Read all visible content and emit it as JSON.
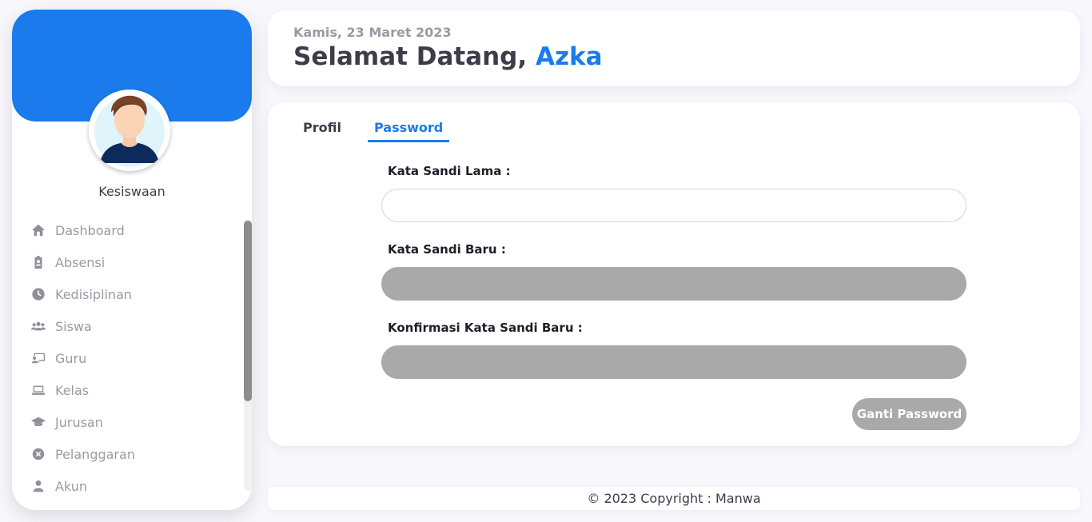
{
  "sidebar": {
    "role": "Kesiswaan",
    "accent_color": "#1b7bec",
    "items": [
      {
        "label": "Dashboard",
        "icon": "home-icon"
      },
      {
        "label": "Absensi",
        "icon": "clipboard-user-icon"
      },
      {
        "label": "Kedisiplinan",
        "icon": "clock-icon"
      },
      {
        "label": "Siswa",
        "icon": "users-icon"
      },
      {
        "label": "Guru",
        "icon": "chalkboard-teacher-icon"
      },
      {
        "label": "Kelas",
        "icon": "laptop-icon"
      },
      {
        "label": "Jurusan",
        "icon": "graduation-cap-icon"
      },
      {
        "label": "Pelanggaran",
        "icon": "circle-x-icon"
      },
      {
        "label": "Akun",
        "icon": "user-icon"
      }
    ]
  },
  "header": {
    "date": "Kamis, 23 Maret 2023",
    "greeting": "Selamat Datang,",
    "user_name": "Azka"
  },
  "tabs": {
    "profil": "Profil",
    "password": "Password",
    "active": "password"
  },
  "form": {
    "old_password_label": "Kata Sandi Lama :",
    "old_password_value": "",
    "new_password_label": "Kata Sandi Baru :",
    "new_password_value": "",
    "confirm_password_label": "Konfirmasi Kata Sandi Baru :",
    "confirm_password_value": "",
    "submit_label": "Ganti Password"
  },
  "footer": {
    "text": "© 2023 Copyright : Manwa"
  }
}
